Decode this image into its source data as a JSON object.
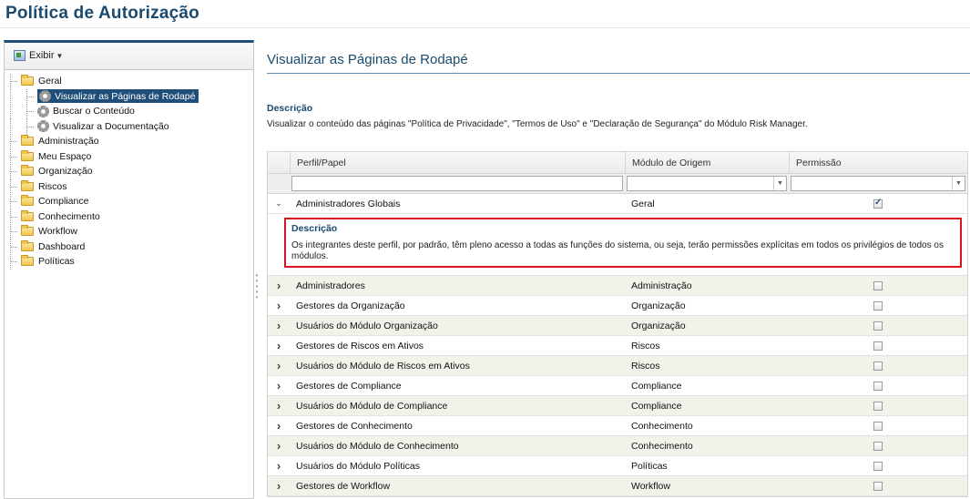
{
  "page_title": "Política de Autorização",
  "left": {
    "toolbar": {
      "exibir_label": "Exibir"
    },
    "tree": [
      {
        "label": "Geral",
        "type": "folder",
        "level": 0
      },
      {
        "label": "Visualizar as Páginas de Rodapé",
        "type": "gear",
        "level": 1,
        "selected": true
      },
      {
        "label": "Buscar o Conteúdo",
        "type": "gear",
        "level": 1
      },
      {
        "label": "Visualizar a Documentação",
        "type": "gear",
        "level": 1
      },
      {
        "label": "Administração",
        "type": "folder",
        "level": 0
      },
      {
        "label": "Meu Espaço",
        "type": "folder",
        "level": 0
      },
      {
        "label": "Organização",
        "type": "folder",
        "level": 0
      },
      {
        "label": "Riscos",
        "type": "folder",
        "level": 0
      },
      {
        "label": "Compliance",
        "type": "folder",
        "level": 0
      },
      {
        "label": "Conhecimento",
        "type": "folder",
        "level": 0
      },
      {
        "label": "Workflow",
        "type": "folder",
        "level": 0
      },
      {
        "label": "Dashboard",
        "type": "folder",
        "level": 0
      },
      {
        "label": "Políticas",
        "type": "folder",
        "level": 0
      }
    ]
  },
  "main": {
    "section_title": "Visualizar as Páginas de Rodapé",
    "description_label": "Descrição",
    "description_text": "Visualizar o conteúdo das páginas \"Política de Privacidade\", \"Termos de Uso\" e \"Declaração de Segurança\" do Módulo Risk Manager.",
    "grid": {
      "columns": {
        "perfil": "Perfil/Papel",
        "modulo": "Módulo de Origem",
        "permissao": "Permissão"
      },
      "expanded_row": {
        "perfil": "Administradores Globais",
        "modulo": "Geral",
        "checked": true,
        "detail_title": "Descrição",
        "detail_text": "Os integrantes deste perfil, por padrão, têm pleno acesso a todas as funções do sistema, ou seja, terão permissões explícitas em todos os privilégios de todos os módulos."
      },
      "rows": [
        {
          "perfil": "Administradores",
          "modulo": "Administração",
          "checked": false
        },
        {
          "perfil": "Gestores da Organização",
          "modulo": "Organização",
          "checked": false
        },
        {
          "perfil": "Usuários do Módulo Organização",
          "modulo": "Organização",
          "checked": false
        },
        {
          "perfil": "Gestores de Riscos em Ativos",
          "modulo": "Riscos",
          "checked": false
        },
        {
          "perfil": "Usuários do Módulo de Riscos em Ativos",
          "modulo": "Riscos",
          "checked": false
        },
        {
          "perfil": "Gestores de Compliance",
          "modulo": "Compliance",
          "checked": false
        },
        {
          "perfil": "Usuários do Módulo de Compliance",
          "modulo": "Compliance",
          "checked": false
        },
        {
          "perfil": "Gestores de Conhecimento",
          "modulo": "Conhecimento",
          "checked": false
        },
        {
          "perfil": "Usuários do Módulo de Conhecimento",
          "modulo": "Conhecimento",
          "checked": false
        },
        {
          "perfil": "Usuários do Módulo Políticas",
          "modulo": "Políticas",
          "checked": false
        },
        {
          "perfil": "Gestores de Workflow",
          "modulo": "Workflow",
          "checked": false
        }
      ]
    }
  }
}
